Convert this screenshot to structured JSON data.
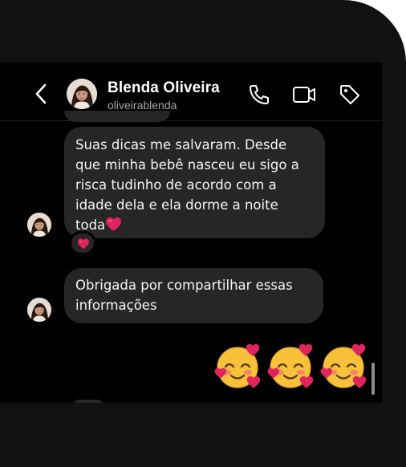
{
  "header": {
    "name": "Blenda Oliveira",
    "handle": "oliveirablenda",
    "icons": [
      "back-chevron-icon",
      "phone-icon",
      "video-camera-icon",
      "tag-icon"
    ]
  },
  "messages": [
    {
      "sender": "contact",
      "text": "Suas dicas me salvaram. Desde\nque minha bebê nasceu eu sigo a\nrisca tudinho de acordo com a\nidade dela e ela dorme a noite\ntoda",
      "trailing_emoji": "red-heart",
      "reaction": "red-heart"
    },
    {
      "sender": "contact",
      "text": "Obrigada por compartilhar essas\ninformações"
    },
    {
      "sender": "me",
      "emojis": [
        "smiling-face-with-hearts",
        "smiling-face-with-hearts",
        "smiling-face-with-hearts"
      ]
    }
  ],
  "colors": {
    "background": "#000000",
    "bezel": "#111111",
    "bubble": "#262626",
    "text": "#f5f5f5",
    "subtext": "#a8a8a8",
    "heart": "#e0245e"
  }
}
